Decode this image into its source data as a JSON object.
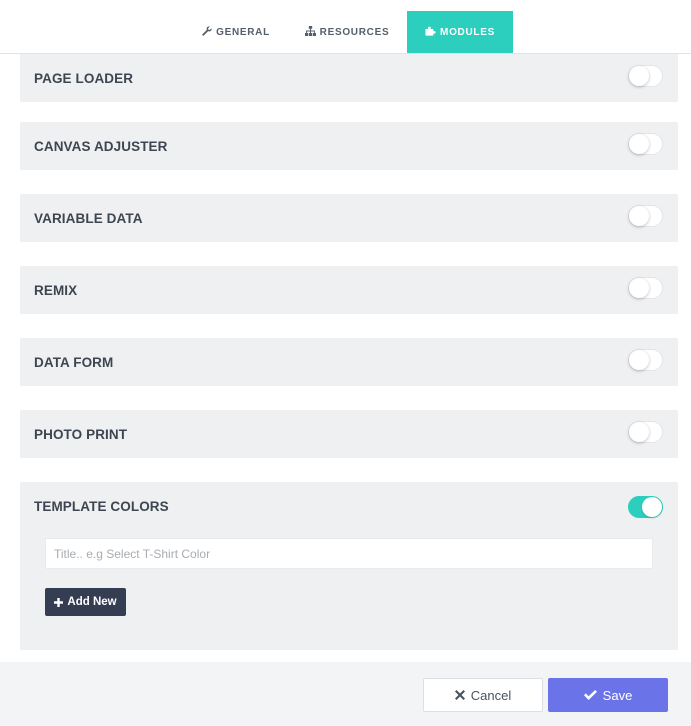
{
  "tabs": [
    {
      "label": "GENERAL",
      "icon": "wrench-icon",
      "glyph": "🔧",
      "active": false
    },
    {
      "label": "RESOURCES",
      "icon": "sitemap-icon",
      "glyph": "",
      "active": false
    },
    {
      "label": "MODULES",
      "icon": "puzzle-icon",
      "glyph": "",
      "active": true
    }
  ],
  "modules": [
    {
      "label": "PAGE LOADER",
      "enabled": false
    },
    {
      "label": "CANVAS ADJUSTER",
      "enabled": false
    },
    {
      "label": "VARIABLE DATA",
      "enabled": false
    },
    {
      "label": "REMIX",
      "enabled": false
    },
    {
      "label": "DATA FORM",
      "enabled": false
    },
    {
      "label": "PHOTO PRINT",
      "enabled": false
    },
    {
      "label": "TEMPLATE COLORS",
      "enabled": true
    }
  ],
  "template_colors": {
    "title_placeholder": "Title.. e.g Select T-Shirt Color",
    "title_value": "",
    "add_label": "Add New"
  },
  "footer": {
    "cancel_label": "Cancel",
    "save_label": "Save"
  },
  "colors": {
    "accent": "#2ccfbd",
    "save": "#6b73e8",
    "add_button": "#353d52",
    "row_bg": "#eff0f2"
  }
}
